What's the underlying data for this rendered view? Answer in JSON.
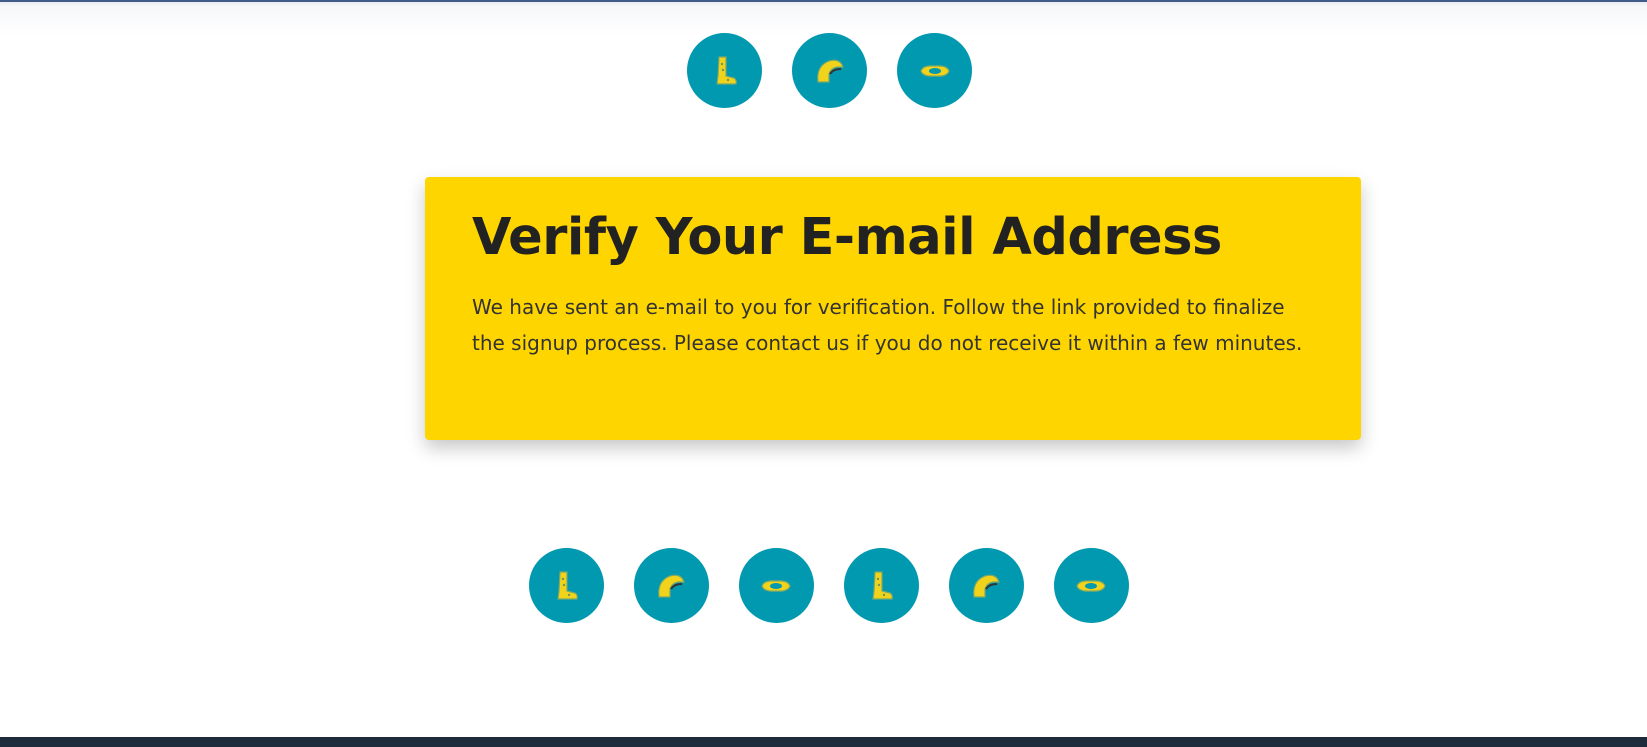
{
  "verify": {
    "title": "Verify Your E-mail Address",
    "message": "We have sent an e-mail to you for verification. Follow the link provided to finalize the signup process. Please contact us if you do not receive it within a few minutes."
  },
  "icons": {
    "top": [
      "boot-icon",
      "helmet-icon",
      "goggles-icon"
    ],
    "bottom": [
      "boot-icon",
      "helmet-icon",
      "goggles-icon",
      "boot-icon",
      "helmet-icon",
      "goggles-icon"
    ]
  },
  "colors": {
    "accent_circle": "#0099b0",
    "card_background": "#ffd500",
    "icon_yellow": "#f2d31b",
    "footer": "#1e2b3a",
    "text": "#262626"
  }
}
